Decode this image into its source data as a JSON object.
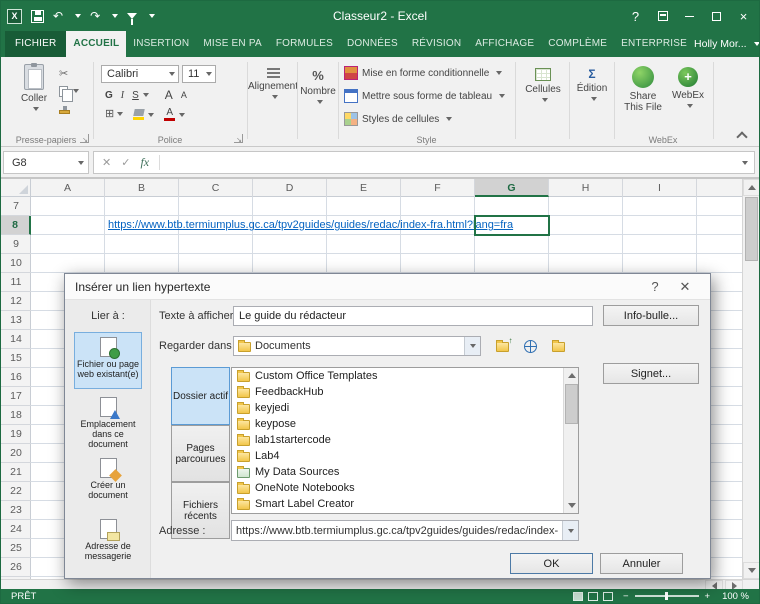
{
  "icons": {
    "undo": "↶",
    "redo": "↷",
    "scissors": "✂",
    "cancel": "✕",
    "enter": "✓",
    "close": "×",
    "help": "?",
    "minimize": "–"
  },
  "titlebar": {
    "title": "Classeur2 - Excel",
    "user": "Holly Mor..."
  },
  "tabs": [
    {
      "label": "FICHIER"
    },
    {
      "label": "ACCUEIL"
    },
    {
      "label": "INSERTION"
    },
    {
      "label": "MISE EN PA"
    },
    {
      "label": "FORMULES"
    },
    {
      "label": "DONNÉES"
    },
    {
      "label": "RÉVISION"
    },
    {
      "label": "AFFICHAGE"
    },
    {
      "label": "COMPLÈME"
    },
    {
      "label": "ENTERPRISE"
    }
  ],
  "ribbon": {
    "clipboard": {
      "paste": "Coller",
      "group": "Presse-papiers"
    },
    "font": {
      "name": "Calibri",
      "size": "11",
      "bold": "G",
      "italic": "I",
      "underline": "S",
      "grow": "A",
      "shrink": "A",
      "borders": "⊞",
      "color": "A",
      "group": "Police"
    },
    "alignment": {
      "label": "Alignement"
    },
    "number": {
      "label": "Nombre",
      "percent": "%"
    },
    "style": {
      "conditional": "Mise en forme conditionnelle",
      "format_table": "Mettre sous forme de tableau",
      "cell_styles": "Styles de cellules",
      "group": "Style"
    },
    "cells": {
      "label": "Cellules"
    },
    "editing": {
      "label": "Édition"
    },
    "webex": {
      "share_line1": "Share",
      "share_line2": "This File",
      "webex": "WebEx",
      "group": "WebEx"
    }
  },
  "formula_bar": {
    "name_box": "G8",
    "fx": "fx",
    "formula": ""
  },
  "grid": {
    "columns": [
      "A",
      "B",
      "C",
      "D",
      "E",
      "F",
      "G",
      "H",
      "I"
    ],
    "rows": [
      "7",
      "8",
      "9",
      "10",
      "11",
      "12",
      "13",
      "14",
      "15",
      "16",
      "17",
      "18",
      "19",
      "20",
      "21",
      "22",
      "23",
      "24",
      "25",
      "26"
    ],
    "selected_cell": "G8",
    "hyperlink_text": "https://www.btb.termiumplus.gc.ca/tpv2guides/guides/redac/index-fra.html?lang=fra"
  },
  "dialog": {
    "title": "Insérer un lien hypertexte",
    "link_to_label": "Lier à :",
    "sidebar": [
      {
        "label": "Fichier ou page web existant(e)"
      },
      {
        "label": "Emplacement dans ce document"
      },
      {
        "label": "Créer un document"
      },
      {
        "label": "Adresse de messagerie"
      }
    ],
    "display_text_label": "Texte à afficher :",
    "display_text_value": "Le guide du rédacteur",
    "screentip_button": "Info-bulle...",
    "look_in_label": "Regarder dans :",
    "look_in_value": "Documents",
    "bookmark_button": "Signet...",
    "nav_buttons": [
      {
        "label": "Dossier actif"
      },
      {
        "label": "Pages parcourues"
      },
      {
        "label": "Fichiers récents"
      }
    ],
    "files": [
      {
        "name": "Custom Office Templates"
      },
      {
        "name": "FeedbackHub"
      },
      {
        "name": "keyjedi"
      },
      {
        "name": "keypose"
      },
      {
        "name": "lab1startercode"
      },
      {
        "name": "Lab4"
      },
      {
        "name": "My Data Sources"
      },
      {
        "name": "OneNote Notebooks"
      },
      {
        "name": "Smart Label Creator"
      }
    ],
    "address_label": "Adresse :",
    "address_value": "https://www.btb.termiumplus.gc.ca/tpv2guides/guides/redac/index-",
    "ok_button": "OK",
    "cancel_button": "Annuler"
  },
  "status_bar": {
    "mode": "PRÊT",
    "zoom": "100 %"
  }
}
